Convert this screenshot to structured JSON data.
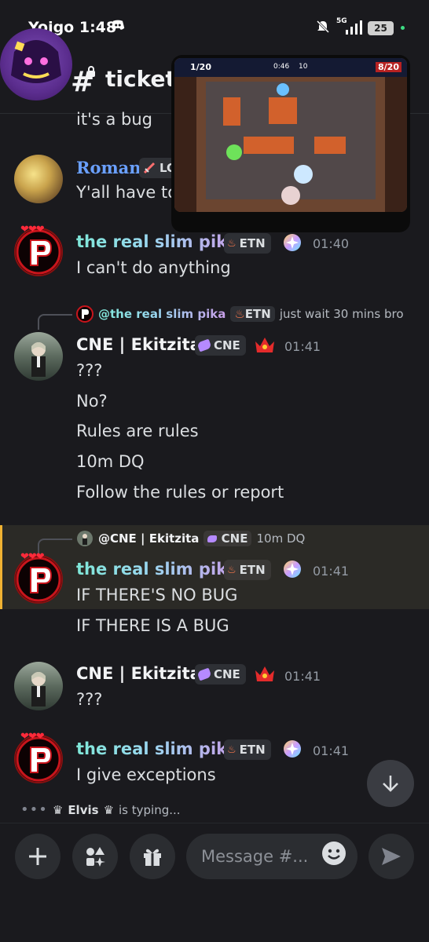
{
  "status_bar": {
    "carrier_time": "Yoigo 1:48",
    "network": "5G",
    "battery": "25"
  },
  "header": {
    "channel_name": "ticket-",
    "hash": "#"
  },
  "messages": {
    "m0": {
      "text": "it's a bug"
    },
    "m1": {
      "username": "Roman",
      "tag": "LO",
      "text": "Y'all have to"
    },
    "m2": {
      "username": "the real slim pika",
      "tag": "ETN",
      "time": "01:40",
      "text": "I can't do anything"
    },
    "m3": {
      "reply_mention": "@the real slim pika",
      "reply_tag": "ETN",
      "reply_text": "just wait 30 mins bro",
      "username": "CNE | Ekitzita",
      "tag": "CNE",
      "time": "01:41",
      "lines": [
        "???",
        "No?",
        "Rules are rules",
        "10m DQ",
        "Follow the rules or report"
      ]
    },
    "m4": {
      "reply_mention": "@CNE | Ekitzita",
      "reply_tag": "CNE",
      "reply_text": "10m DQ",
      "username": "the real slim pika",
      "tag": "ETN",
      "time": "01:41",
      "lines": [
        "IF THERE'S NO BUG",
        "IF THERE IS A BUG"
      ]
    },
    "m5": {
      "username": "CNE | Ekitzita",
      "tag": "CNE",
      "time": "01:41",
      "text": "???"
    },
    "m6": {
      "username": "the real slim pika",
      "tag": "ETN",
      "time": "01:41",
      "text": "I give exceptions"
    }
  },
  "typing": {
    "user": "Elvis",
    "suffix": "is typing..."
  },
  "composer": {
    "placeholder": "Message #..."
  },
  "pip_overlay": {
    "left_score": "1/20",
    "timer": "0:46",
    "count": "10",
    "right_score": "8/20"
  },
  "colors": {
    "background": "#1a1a1e",
    "highlight_border": "#f0b232",
    "username_cne": "#f2f3f5",
    "username_roman": "#6aa0ff"
  }
}
